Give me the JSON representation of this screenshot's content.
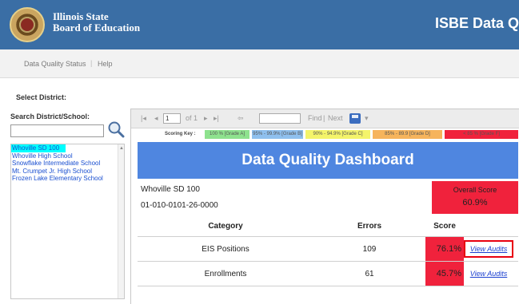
{
  "header": {
    "org_line1": "Illinois State",
    "org_line2": "Board of Education",
    "app_title": "ISBE Data Q"
  },
  "nav": {
    "items": [
      "Data Quality Status",
      "Help"
    ],
    "separator": "|"
  },
  "select_district_label": "Select District:",
  "search": {
    "label": "Search District/School:",
    "value": ""
  },
  "schools": [
    "Whoville SD 100",
    "Whoville High School",
    "Snowflake Intermediate School",
    "Mt. Crumpet Jr. High School",
    "Frozen Lake Elementary School"
  ],
  "toolbar": {
    "first": "|◂",
    "prev": "◂",
    "page_value": "1",
    "of_pages": "of 1",
    "next": "▸",
    "last": "▸|",
    "back": "⇦",
    "find": "Find",
    "sep": "|",
    "next_find": "Next",
    "export_arrow": "▾"
  },
  "scoring_key": {
    "label": "Scoring Key :",
    "items": [
      {
        "text": "100 % [Grade A]",
        "color": "#8ee28e"
      },
      {
        "text": "95% - 99.9% [Grade B]",
        "color": "#8fc0ee"
      },
      {
        "text": "90% - 94.9% [Grade C]",
        "color": "#f4f46a"
      },
      {
        "text": "85% - 89.9 [Grade D]",
        "color": "#f6b45c"
      },
      {
        "text": "< 85 % [Grade F]",
        "color": "#f0223c"
      }
    ]
  },
  "dashboard": {
    "title": "Data Quality Dashboard",
    "district_name": "Whoville SD 100",
    "district_code": "01-010-0101-26-0000",
    "overall_label": "Overall Score",
    "overall_value": "60.9%"
  },
  "table": {
    "headers": [
      "Category",
      "Errors",
      "Score",
      ""
    ],
    "rows": [
      {
        "category": "EIS Positions",
        "errors": "109",
        "score": "76.1%",
        "link": "View Audits"
      },
      {
        "category": "Enrollments",
        "errors": "61",
        "score": "45.7%",
        "link": "View Audits"
      }
    ]
  },
  "colors": {
    "header_bg": "#3a6ea5",
    "banner_bg": "#4f86e0",
    "fail_red": "#f0223c",
    "selected_cyan": "#00ffff"
  }
}
